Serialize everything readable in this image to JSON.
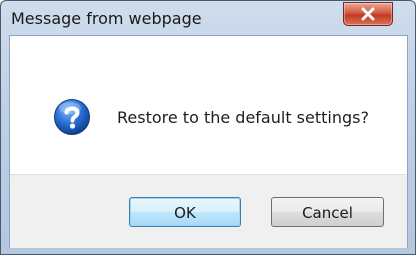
{
  "dialog": {
    "title": "Message from webpage",
    "message": "Restore to the default settings?",
    "icon": "question-icon",
    "ok_label": "OK",
    "cancel_label": "Cancel",
    "close_icon": "close-icon"
  },
  "colors": {
    "close_button": "#c9442b",
    "question_icon": "#1f5fb8",
    "ok_button_border": "#3c7fb1"
  }
}
